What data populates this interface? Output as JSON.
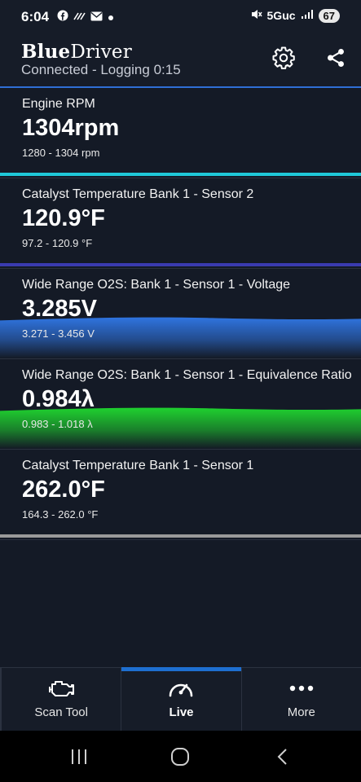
{
  "status_bar": {
    "time": "6:04",
    "network": "5Guc",
    "battery": "67",
    "icons": [
      "facebook-icon",
      "voicemail-icon",
      "mail-icon",
      "dot-icon",
      "mute-icon",
      "signal-icon"
    ]
  },
  "header": {
    "brand_part1": "Blue",
    "brand_part2": "Driver",
    "subtitle": "Connected - Logging 0:15",
    "settings_icon": "gear-icon",
    "share_icon": "share-icon"
  },
  "readings": [
    {
      "label": "Engine RPM",
      "value": "1304rpm",
      "range": "1280 - 1304 rpm",
      "gauge_fraction": 0.05,
      "color": "#1fc8d8"
    },
    {
      "label": "Catalyst Temperature Bank 1 - Sensor 2",
      "value": "120.9°F",
      "range": "97.2 - 120.9 °F",
      "gauge_fraction": 0.05,
      "color": "#3a3bb0"
    },
    {
      "label": "Wide Range O2S: Bank 1 - Sensor 1 - Voltage",
      "value": "3.285V",
      "range": "3.271 - 3.456 V",
      "gauge_fraction": 0.62,
      "color": "#2f74e0"
    },
    {
      "label": "Wide Range O2S: Bank 1 - Sensor 1 - Equivalence Ratio",
      "value": "0.984λ",
      "range": "0.983 - 1.018 λ",
      "gauge_fraction": 0.62,
      "color": "#1fd12f"
    },
    {
      "label": "Catalyst Temperature Bank 1 - Sensor 1",
      "value": "262.0°F",
      "range": "164.3 - 262.0 °F",
      "gauge_fraction": 0.05,
      "color": "#9a9a9a"
    }
  ],
  "nav": {
    "items": [
      {
        "label": "Scan Tool",
        "icon": "engine-icon",
        "active": false
      },
      {
        "label": "Live",
        "icon": "speedometer-icon",
        "active": true
      },
      {
        "label": "More",
        "icon": "more-dots-icon",
        "active": false
      }
    ]
  },
  "system_nav": {
    "icons": [
      "recents-icon",
      "home-icon",
      "back-icon"
    ]
  }
}
